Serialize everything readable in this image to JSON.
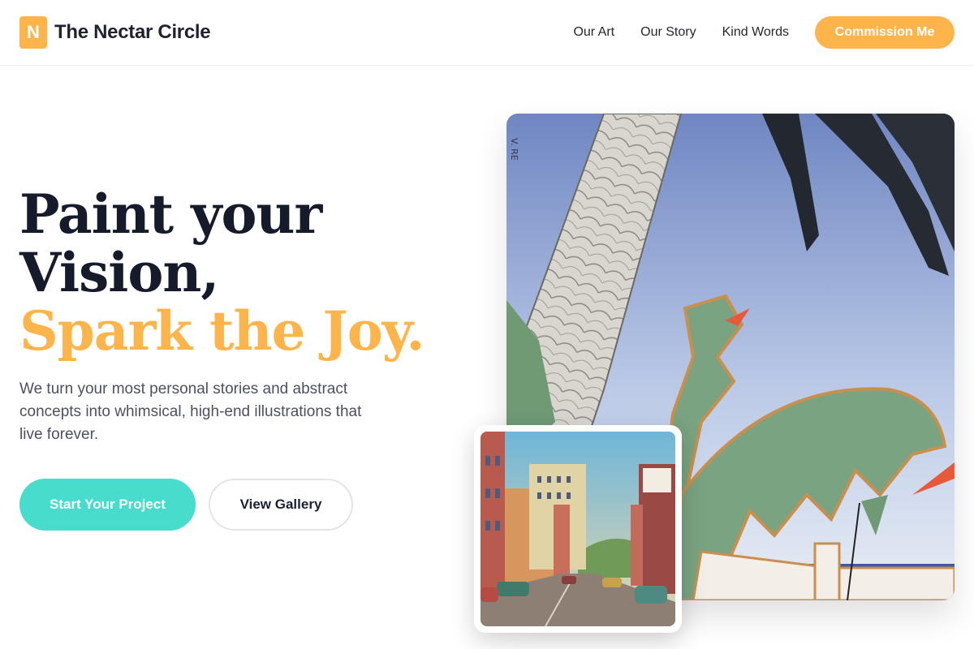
{
  "brand": {
    "mark": "N",
    "name": "The Nectar Circle"
  },
  "nav": {
    "items": [
      {
        "label": "Our Art"
      },
      {
        "label": "Our Story"
      },
      {
        "label": "Kind Words"
      }
    ],
    "cta_label": "Commission Me"
  },
  "hero": {
    "title_line1": "Paint your",
    "title_line2": "Vision,",
    "title_accent": "Spark the Joy.",
    "description": "We turn your most personal stories and abstract concepts into whimsical, high-end illustrations that live forever.",
    "primary_button": "Start Your Project",
    "secondary_button": "View Gallery"
  },
  "colors": {
    "accent": "#fdb44b",
    "teal": "#47dccb",
    "heading": "#161b2c"
  },
  "images": {
    "main": "tropical-palm-poster-illustration",
    "secondary": "vintage-street-postcard-illustration"
  }
}
